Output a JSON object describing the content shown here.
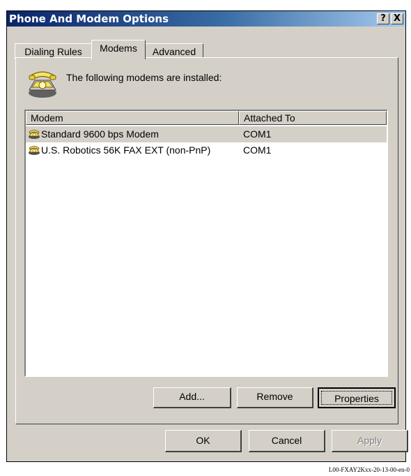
{
  "window": {
    "title": "Phone And Modem Options",
    "help_button": "?",
    "close_button": "X"
  },
  "tabs": [
    {
      "label": "Dialing Rules",
      "active": false
    },
    {
      "label": "Modems",
      "active": true
    },
    {
      "label": "Advanced",
      "active": false
    }
  ],
  "heading": "The following modems are  installed:",
  "list": {
    "columns": [
      "Modem",
      "Attached To"
    ],
    "rows": [
      {
        "modem": "Standard  9600 bps Modem",
        "port": "COM1",
        "selected": true,
        "icon": "phone-icon"
      },
      {
        "modem": "U.S. Robotics 56K FAX EXT (non-PnP)",
        "port": "COM1",
        "selected": false,
        "icon": "phone-icon"
      }
    ]
  },
  "panel_buttons": {
    "add": "Add...",
    "remove": "Remove",
    "properties": "Properties"
  },
  "dialog_buttons": {
    "ok": "OK",
    "cancel": "Cancel",
    "apply": "Apply"
  },
  "caption": "L00-FXAY2Kxx-20-13-00-en-0",
  "colors": {
    "titlebar": "#0a246a",
    "face": "#d4d0c8"
  }
}
